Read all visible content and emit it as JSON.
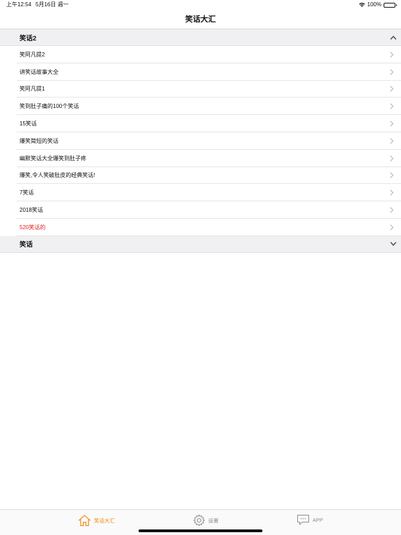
{
  "status_bar": {
    "time": "上午12:54",
    "date": "5月16日 週一",
    "battery": "100%"
  },
  "nav": {
    "title": "笑话大汇"
  },
  "sections": [
    {
      "title": "笑话2",
      "expanded": true,
      "items": [
        {
          "label": "笑阿凡提2"
        },
        {
          "label": "讲笑话故事大全"
        },
        {
          "label": "笑阿凡提1"
        },
        {
          "label": "笑到肚子痛的100个笑话"
        },
        {
          "label": "15笑话"
        },
        {
          "label": "爆笑简短的笑话"
        },
        {
          "label": "幽默笑话大全爆笑到肚子疼"
        },
        {
          "label": "爆笑,令人笑破肚皮的经典笑话!"
        },
        {
          "label": "7笑话"
        },
        {
          "label": "2018笑话"
        },
        {
          "label": "520笑话的",
          "highlight": true
        }
      ]
    },
    {
      "title": "笑话",
      "expanded": false,
      "items": []
    }
  ],
  "tab_bar": {
    "tabs": [
      {
        "label": "笑话大汇",
        "icon": "home-icon",
        "active": true
      },
      {
        "label": "设置",
        "icon": "gear-icon",
        "active": false
      },
      {
        "label": "APP",
        "icon": "chat-bubble-icon",
        "active": false
      }
    ]
  },
  "colors": {
    "accent": "#f08a1c",
    "highlight_text": "#e02020",
    "section_bg": "#f0f0f2",
    "inactive_tab": "#8e8e93"
  }
}
